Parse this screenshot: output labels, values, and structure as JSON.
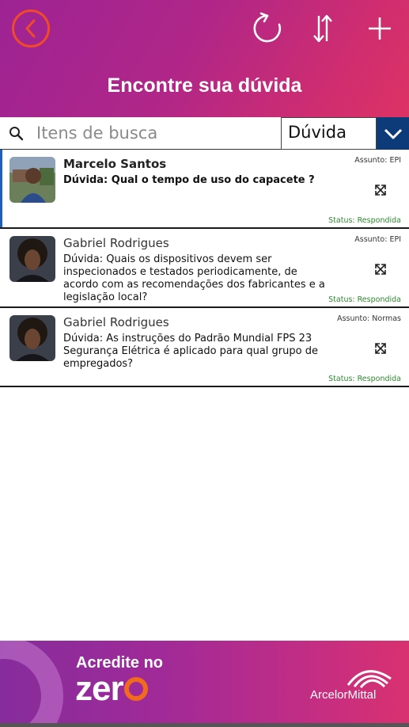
{
  "header": {
    "title": "Encontre sua dúvida",
    "back_icon": "chevron-left-circle-icon",
    "refresh_icon": "refresh-icon",
    "sort_icon": "sort-arrows-icon",
    "add_icon": "plus-icon",
    "gradient_start": "#9d2394",
    "gradient_end": "#dd3264",
    "back_color": "#f04a2a"
  },
  "search": {
    "placeholder": "Itens de busca",
    "value": "",
    "filter_selected": "Dúvida",
    "dropdown_color": "#0d3a78"
  },
  "questions": [
    {
      "name": "Marcelo Santos",
      "question": "Dúvida: Qual o tempo de uso do capacete ?",
      "subject": "Assunto: EPI",
      "status": "Status: Respondida",
      "selected": true
    },
    {
      "name": "Gabriel Rodrigues",
      "question": "Dúvida: Quais os dispositivos devem ser inspecionados e testados periodicamente, de acordo com as recomendações dos fabricantes e a legislação local?",
      "subject": "Assunto: EPI",
      "status": "Status: Respondida",
      "selected": false
    },
    {
      "name": "Gabriel Rodrigues",
      "question": "Dúvida: As instruções do Padrão Mundial FPS 23 Segurança Elétrica é aplicado para qual grupo de empregados?",
      "subject": "Assunto: Normas",
      "status": "Status: Respondida",
      "selected": false
    }
  ],
  "footer": {
    "tagline_top": "Acredite no",
    "tagline_zero": "zer",
    "brand": "ArcelorMittal",
    "status_color": "#2e8b2e"
  }
}
